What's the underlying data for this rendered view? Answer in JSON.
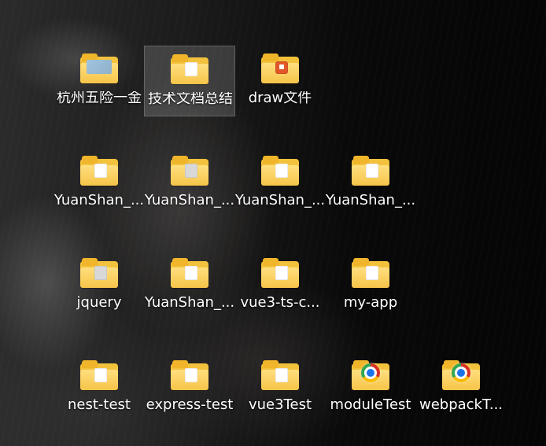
{
  "desktop": {
    "icons": [
      {
        "label": "杭州五险一金",
        "selected": false
      },
      {
        "label": "技术文档总结",
        "selected": true
      },
      {
        "label": "draw文件",
        "selected": false
      },
      {
        "label": "YuanShan_...",
        "selected": false
      },
      {
        "label": "YuanShan_...",
        "selected": false
      },
      {
        "label": "YuanShan_...",
        "selected": false
      },
      {
        "label": "YuanShan_...",
        "selected": false
      },
      {
        "label": "jquery",
        "selected": false
      },
      {
        "label": "YuanShan_...",
        "selected": false
      },
      {
        "label": "vue3-ts-c...",
        "selected": false
      },
      {
        "label": "my-app",
        "selected": false
      },
      {
        "label": "nest-test",
        "selected": false
      },
      {
        "label": "express-test",
        "selected": false
      },
      {
        "label": "vue3Test",
        "selected": false
      },
      {
        "label": "moduleTest",
        "selected": false
      },
      {
        "label": "webpackT...",
        "selected": false
      }
    ]
  },
  "icon_names": {
    "folder": "folder-icon",
    "draw_folder": "draw-folder-icon",
    "chrome_folder": "chrome-folder-icon"
  },
  "colors": {
    "folder_back": "#f3c23d",
    "folder_front": "#ffdf7f",
    "selection": "rgba(255,255,255,0.16)"
  }
}
